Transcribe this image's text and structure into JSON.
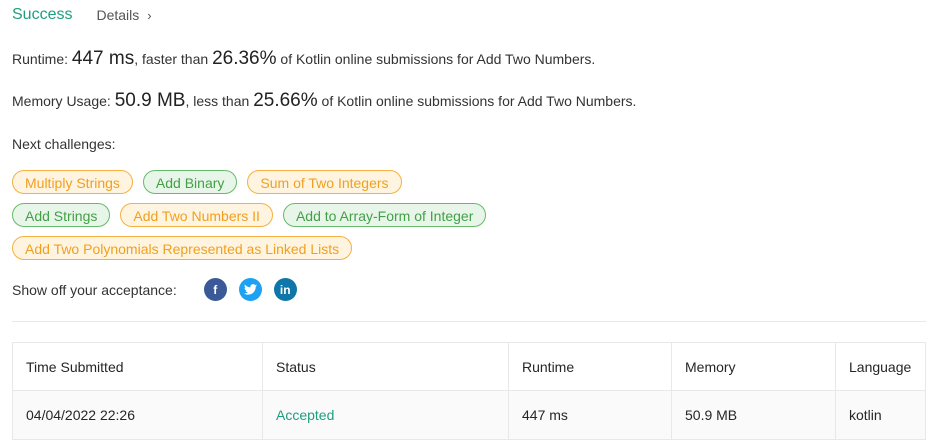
{
  "header": {
    "status": "Success",
    "details_label": "Details",
    "details_chevron": "›"
  },
  "runtime": {
    "label": "Runtime:",
    "value": "447 ms",
    "comparison_prefix": ", faster than",
    "percent": "26.36%",
    "suffix": "of Kotlin online submissions for Add Two Numbers."
  },
  "memory": {
    "label": "Memory Usage:",
    "value": "50.9 MB",
    "comparison_prefix": ", less than",
    "percent": "25.66%",
    "suffix": "of Kotlin online submissions for Add Two Numbers."
  },
  "next_challenges": {
    "label": "Next challenges:",
    "items": [
      {
        "label": "Multiply Strings",
        "difficulty_color": "orange"
      },
      {
        "label": "Add Binary",
        "difficulty_color": "green"
      },
      {
        "label": "Sum of Two Integers",
        "difficulty_color": "orange"
      },
      {
        "label": "Add Strings",
        "difficulty_color": "green"
      },
      {
        "label": "Add Two Numbers II",
        "difficulty_color": "orange"
      },
      {
        "label": "Add to Array-Form of Integer",
        "difficulty_color": "green"
      },
      {
        "label": "Add Two Polynomials Represented as Linked Lists",
        "difficulty_color": "orange"
      }
    ]
  },
  "share": {
    "label": "Show off your acceptance:",
    "icons": [
      {
        "name": "facebook-icon",
        "glyph": "f",
        "color": "#3b5998"
      },
      {
        "name": "twitter-icon",
        "glyph": "t",
        "color": "#1da1f2"
      },
      {
        "name": "linkedin-icon",
        "glyph": "in",
        "color": "#0e76a8"
      }
    ]
  },
  "table": {
    "headers": [
      "Time Submitted",
      "Status",
      "Runtime",
      "Memory",
      "Language"
    ],
    "rows": [
      [
        "04/04/2022 22:26",
        "Accepted",
        "447 ms",
        "50.9 MB",
        "kotlin"
      ]
    ]
  },
  "colors": {
    "accent": "#1f9e7e",
    "orange": "#f0a020",
    "green": "#43a047"
  }
}
